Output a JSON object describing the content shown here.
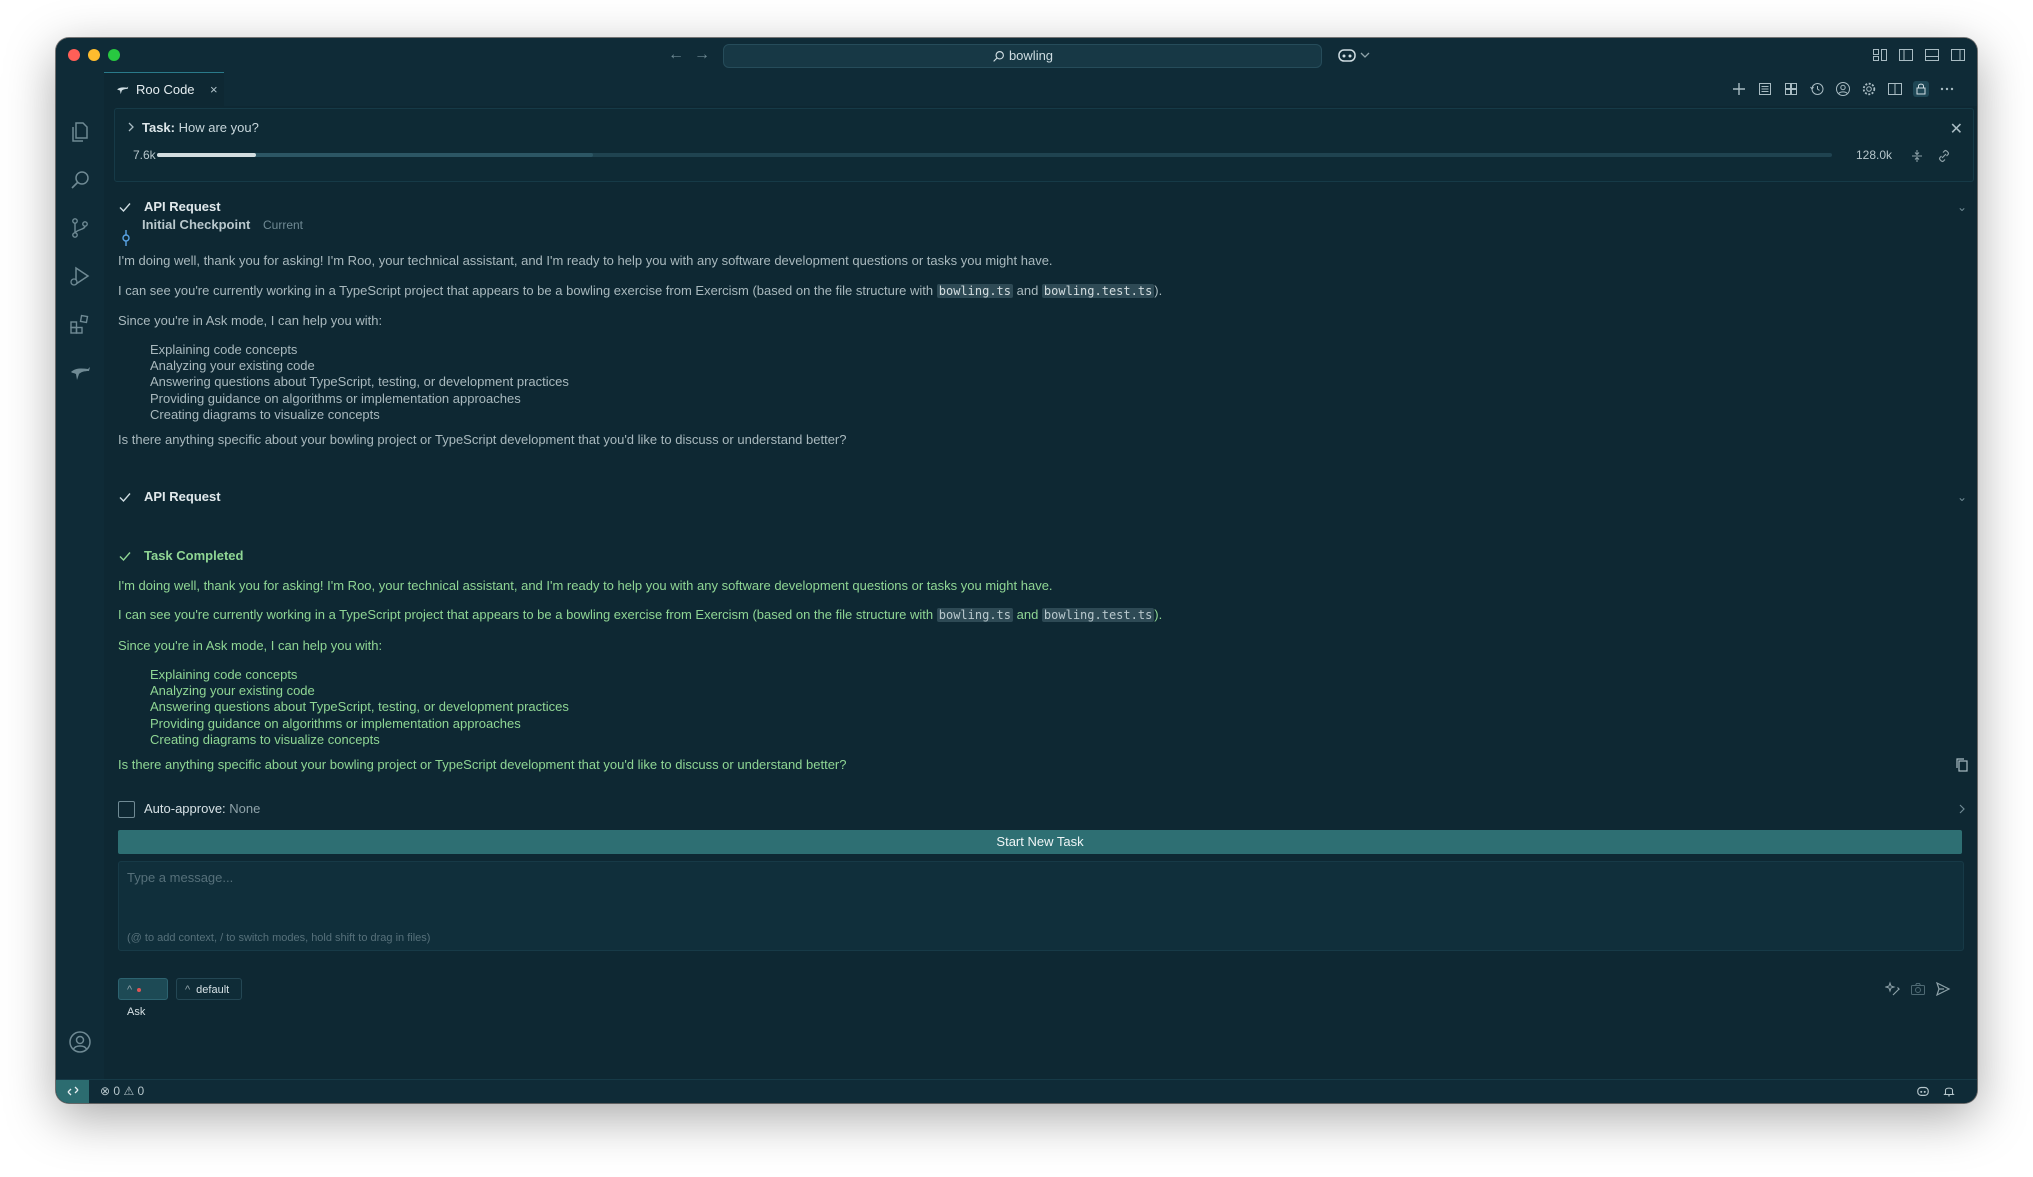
{
  "search": {
    "text": "bowling"
  },
  "tab": {
    "label": "Roo Code",
    "close": "×"
  },
  "task": {
    "label": "Task:",
    "text": "How are you?",
    "tokens_used": "7.6k",
    "tokens_max": "128.0k",
    "context_progress": 0.059,
    "context_window_fill": 0.26
  },
  "messages": {
    "api_request_1": "API Request",
    "checkpoint_label": "Initial Checkpoint",
    "checkpoint_status": "Current",
    "p1": "I'm doing well, thank you for asking! I'm Roo, your technical assistant, and I'm ready to help you with any software development questions or tasks you might have.",
    "p2_prefix": "I can see you're currently working in a TypeScript project that appears to be a bowling exercise from Exercism (based on the file structure with ",
    "file1": "bowling.ts",
    "and": " and ",
    "file2": "bowling.test.ts",
    "p2_suffix": ").",
    "p3": "Since you're in Ask mode, I can help you with:",
    "list": [
      "Explaining code concepts",
      "Analyzing your existing code",
      "Answering questions about TypeScript, testing, or development practices",
      "Providing guidance on algorithms or implementation approaches",
      "Creating diagrams to visualize concepts"
    ],
    "p4": "Is there anything specific about your bowling project or TypeScript development that you'd like to discuss or understand better?",
    "api_request_2": "API Request",
    "task_completed": "Task Completed"
  },
  "auto_approve": {
    "label": "Auto-approve:",
    "value": "None"
  },
  "start_new_task": "Start New Task",
  "input": {
    "placeholder": "Type a message...",
    "hint": "(@ to add context, / to switch modes, hold shift to drag in files)"
  },
  "mode": {
    "caret": "^",
    "current": "Ask"
  },
  "config": {
    "caret": "^",
    "current": "default"
  },
  "status": {
    "errors": "0",
    "warnings": "0"
  },
  "colors": {
    "accent": "#2e6f73",
    "success": "#8fd694",
    "background": "#0e2833"
  }
}
